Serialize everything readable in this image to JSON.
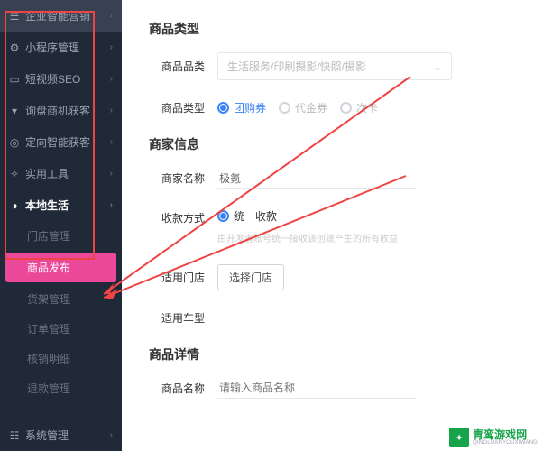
{
  "sidebar": {
    "items": [
      {
        "label": "企业智能营销",
        "icon": "bars"
      },
      {
        "label": "小程序管理",
        "icon": "gear"
      },
      {
        "label": "短视频SEO",
        "icon": "video"
      },
      {
        "label": "询盘商机获客",
        "icon": "funnel"
      },
      {
        "label": "定向智能获客",
        "icon": "target"
      },
      {
        "label": "实用工具",
        "icon": "wrench"
      }
    ],
    "active": {
      "label": "本地生活",
      "icon": "life"
    },
    "subs": [
      {
        "label": "门店管理"
      },
      {
        "label": "商品发布",
        "selected": true
      },
      {
        "label": "货架管理"
      },
      {
        "label": "订单管理"
      },
      {
        "label": "核销明细"
      },
      {
        "label": "退款管理"
      }
    ],
    "bottom": {
      "label": "系统管理",
      "icon": "system"
    }
  },
  "form": {
    "section_type": "商品类型",
    "row_category": {
      "label": "商品品类",
      "placeholder": "生活服务/印刷摄影/快照/摄影"
    },
    "row_goods_type": {
      "label": "商品类型",
      "options": [
        {
          "text": "团购券",
          "on": true
        },
        {
          "text": "代金券",
          "on": false
        },
        {
          "text": "次卡",
          "on": false
        }
      ]
    },
    "section_merchant": "商家信息",
    "row_merchant_name": {
      "label": "商家名称",
      "value": "极氪"
    },
    "row_payment": {
      "label": "收款方式",
      "option": "统一收款",
      "help": "由开发者账号统一接收该创建产生的所有收益"
    },
    "row_store": {
      "label": "适用门店",
      "button": "选择门店"
    },
    "row_car": {
      "label": "适用车型"
    },
    "section_detail": "商品详情",
    "row_product_name": {
      "label": "商品名称",
      "placeholder": "请输入商品名称"
    }
  },
  "watermark": {
    "cn": "青鸾游戏网",
    "en": "QINGLUANYOUXIWANG",
    "glyph": "✦"
  }
}
